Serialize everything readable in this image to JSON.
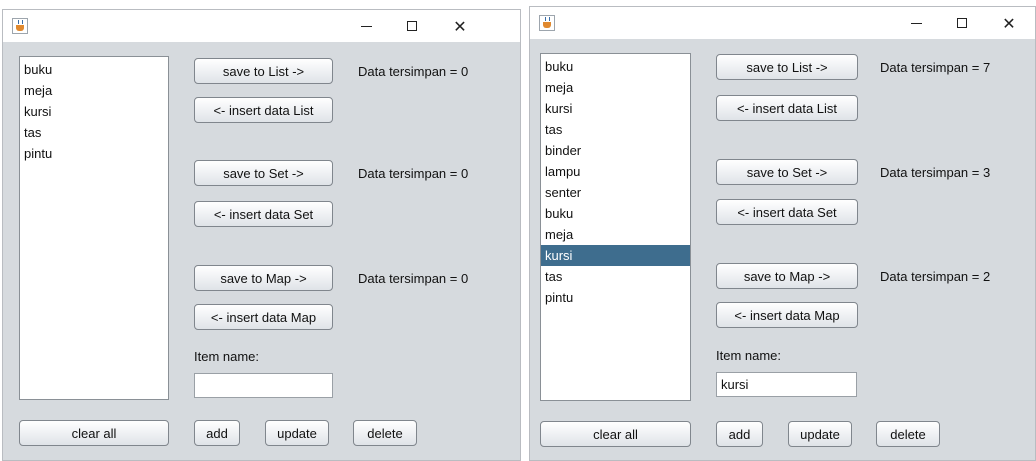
{
  "window_controls": {
    "close": "✕"
  },
  "left": {
    "list_items": [
      "buku",
      "meja",
      "kursi",
      "tas",
      "pintu"
    ],
    "list_count_text": "Data tersimpan = 0",
    "set_count_text": "Data tersimpan = 0",
    "map_count_text": "Data tersimpan = 0",
    "item_name_value": ""
  },
  "right": {
    "list_items": [
      "buku",
      "meja",
      "kursi",
      "tas",
      "binder",
      "lampu",
      "senter",
      "buku",
      "meja",
      "kursi",
      "tas",
      "pintu"
    ],
    "selected_index": 9,
    "list_count_text": "Data tersimpan = 7",
    "set_count_text": "Data tersimpan = 3",
    "map_count_text": "Data tersimpan = 2",
    "item_name_value": "kursi"
  },
  "buttons": {
    "save_list": "save to List ->",
    "insert_list": "<- insert data List",
    "save_set": "save to Set ->",
    "insert_set": "<- insert data Set",
    "save_map": "save to Map ->",
    "insert_map": "<- insert data Map",
    "clear_all": "clear all",
    "add": "add",
    "update": "update",
    "delete": "delete"
  },
  "item_name_label": "Item name:",
  "colors": {
    "selection": "#3e6d8e",
    "window_bg": "#d6dade"
  }
}
